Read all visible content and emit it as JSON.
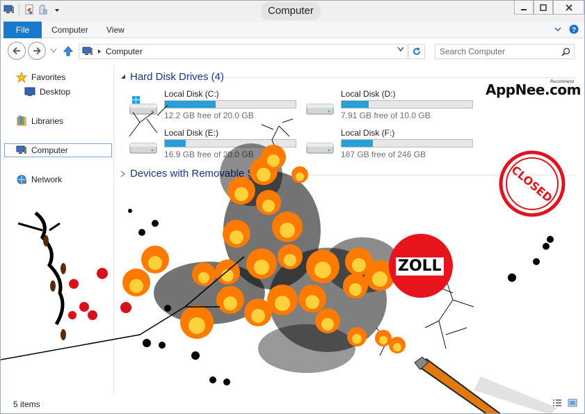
{
  "window": {
    "title": "Computer"
  },
  "ribbon": {
    "tabs": [
      "File",
      "Computer",
      "View"
    ]
  },
  "address": {
    "path": "Computer"
  },
  "search": {
    "placeholder": "Search Computer"
  },
  "nav": {
    "favorites": "Favorites",
    "desktop": "Desktop",
    "libraries": "Libraries",
    "computer": "Computer",
    "network": "Network"
  },
  "groups": {
    "hard_disk": "Hard Disk Drives (4)",
    "removable": "Devices with Removable S"
  },
  "drives": [
    {
      "name": "Local Disk (C:)",
      "free": "12.2 GB free of 20.0 GB",
      "used_fraction": 0.39
    },
    {
      "name": "Local Disk (D:)",
      "free": "7.91 GB free of 10.0 GB",
      "used_fraction": 0.21
    },
    {
      "name": "Local Disk (E:)",
      "free": "16.9 GB free of 20.0 GB",
      "used_fraction": 0.16
    },
    {
      "name": "Local Disk (F:)",
      "free": "187 GB free of 246 GB",
      "used_fraction": 0.24
    }
  ],
  "status": {
    "count": "5 items"
  },
  "overlay": {
    "logo": "AppNee.com",
    "logo_tag": "Recommend",
    "stamp": "CLOSED",
    "sign": "ZOLL"
  },
  "colors": {
    "accent": "#1979ca",
    "bar_fill": "#26a0da",
    "stamp_red": "#e0141e",
    "flame_orange": "#ff8a00",
    "smoke": "#000000"
  }
}
